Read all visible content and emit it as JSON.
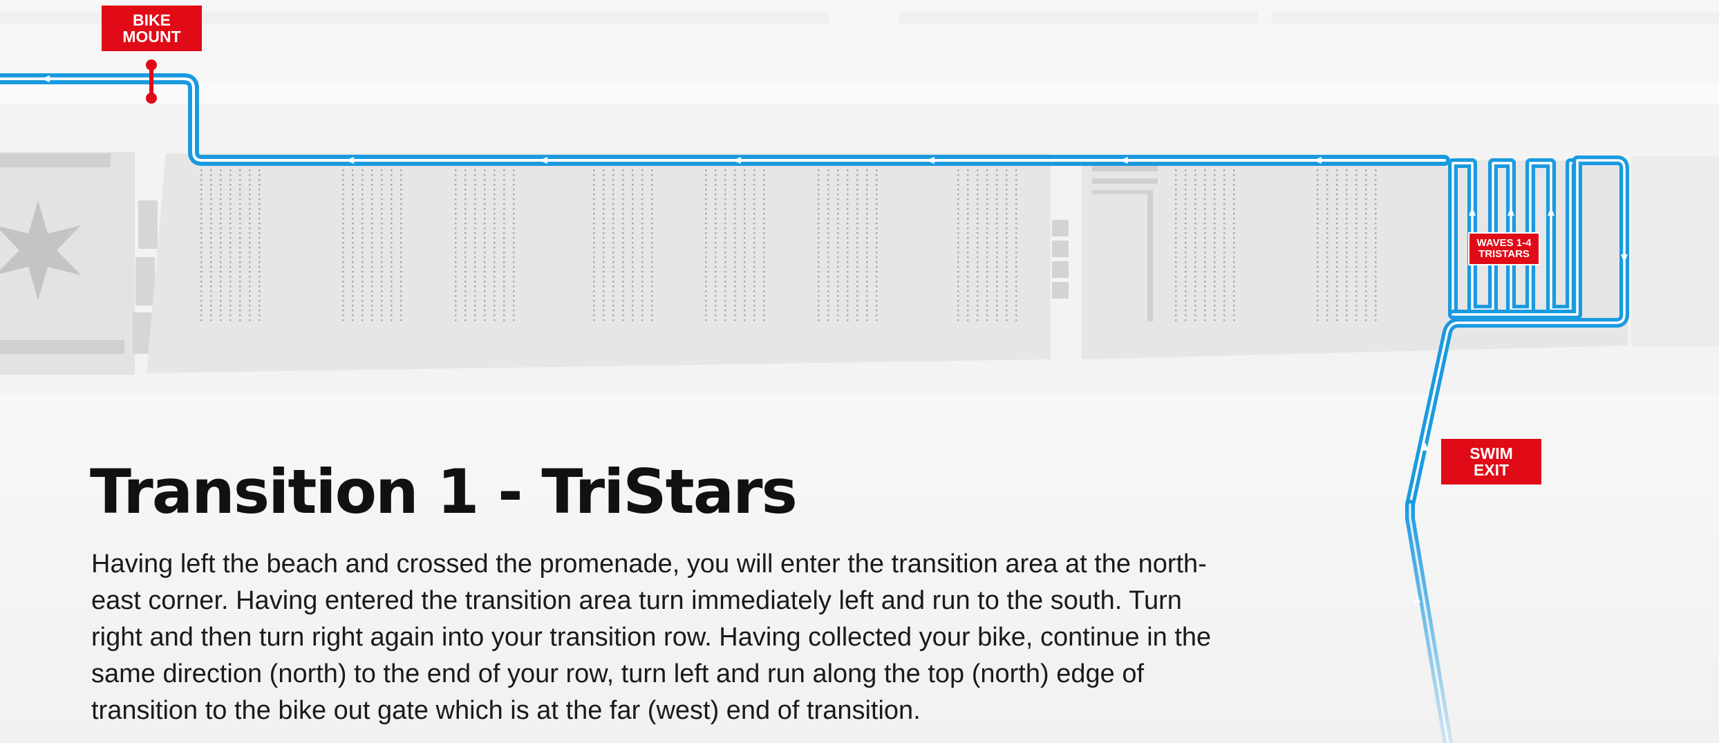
{
  "map": {
    "bike_mount_label": [
      "BIKE",
      "MOUNT"
    ],
    "swim_exit_label": [
      "SWIM",
      "EXIT"
    ],
    "waves_label": [
      "WAVES 1-4",
      "TRISTARS"
    ],
    "route_color": "#1a9ae0",
    "marker_color": "#e10a17"
  },
  "text": {
    "title": "Transition 1 - TriStars",
    "body": "Having left the beach and crossed the promenade, you will enter the transition area at the north-east corner. Having entered the transition area turn immediately left and run to the south. Turn right and then turn right again into your transition row. Having collected your bike, continue in the same direction (north) to the end of your row, turn left and run along the top (north) edge of transition to the bike out gate which is at the far (west) end of transition."
  }
}
